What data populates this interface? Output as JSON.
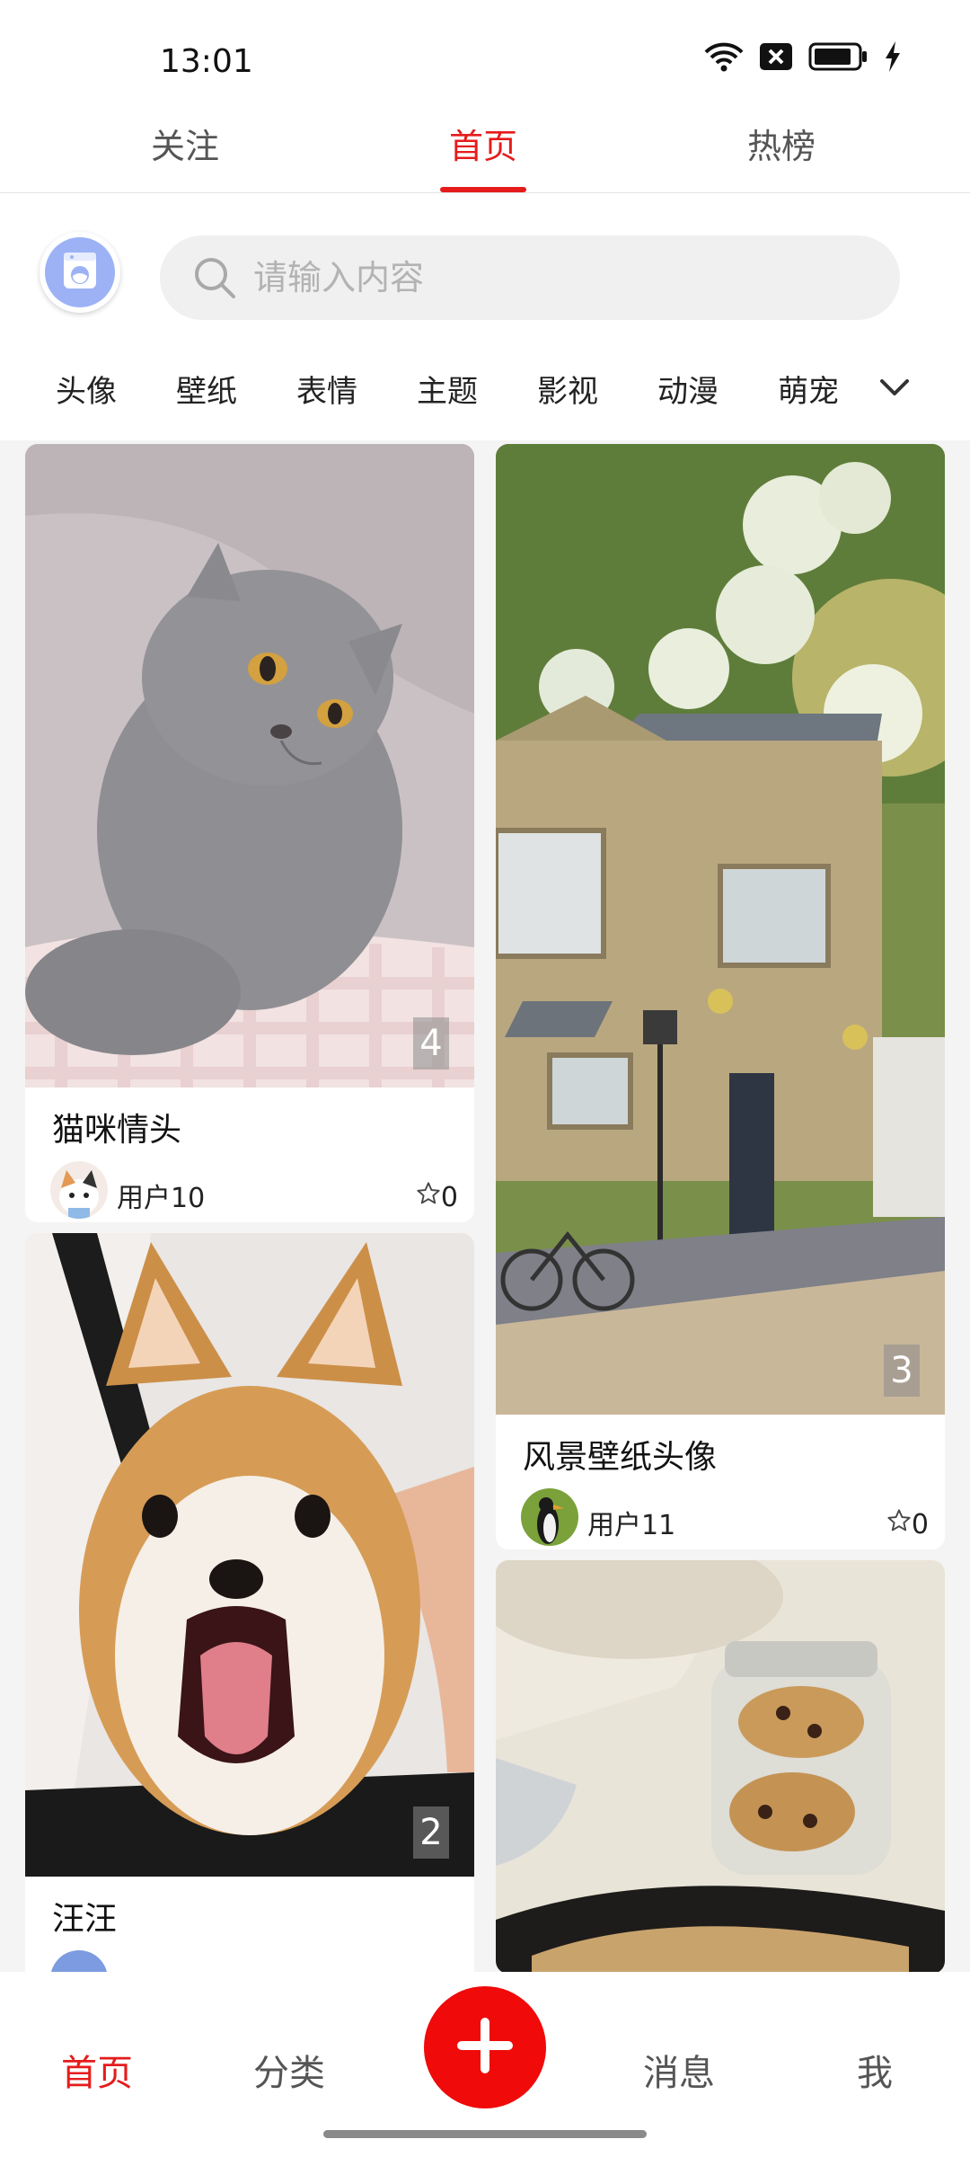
{
  "status_bar": {
    "time": "13:01",
    "icons": [
      "wifi-icon",
      "notification-x-icon",
      "battery-icon",
      "charging-icon"
    ]
  },
  "top_tabs": [
    {
      "label": "关注",
      "active": false
    },
    {
      "label": "首页",
      "active": true
    },
    {
      "label": "热榜",
      "active": false
    }
  ],
  "search": {
    "placeholder": "请输入内容",
    "icon": "search-icon"
  },
  "logo": {
    "icon": "washing-machine-icon"
  },
  "categories": [
    "头像",
    "壁纸",
    "表情",
    "主题",
    "影视",
    "动漫",
    "萌宠"
  ],
  "categories_more_icon": "chevron-down-icon",
  "feed": {
    "left": [
      {
        "title": "猫咪情头",
        "image": "gray-cat-photo",
        "count": "4",
        "user": "用户10",
        "likes": "0"
      },
      {
        "title": "汪汪",
        "image": "shiba-dog-photo",
        "count": "2",
        "user": "",
        "likes": ""
      }
    ],
    "right": [
      {
        "title": "风景壁纸头像",
        "image": "cottage-landscape-photo",
        "count": "3",
        "user": "用户11",
        "likes": "0"
      },
      {
        "title": "",
        "image": "cookie-jar-photo",
        "count": "",
        "user": "",
        "likes": ""
      }
    ]
  },
  "bottom_nav": {
    "items": [
      {
        "label": "首页",
        "active": true
      },
      {
        "label": "分类",
        "active": false
      },
      {
        "label": "消息",
        "active": false
      },
      {
        "label": "我",
        "active": false
      }
    ],
    "fab_icon": "plus-icon"
  },
  "colors": {
    "accent": "#e51c1c",
    "fab": "#f00a0a"
  }
}
